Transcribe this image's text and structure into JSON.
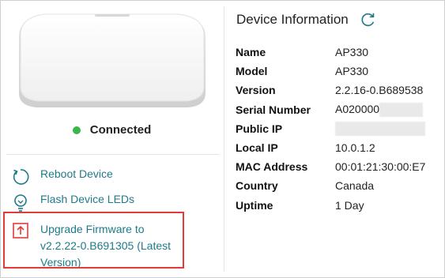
{
  "device": {
    "status_label": "Connected",
    "status_color": "#3cb54a",
    "image_icon": "access-point-image"
  },
  "actions": [
    {
      "label": "Reboot Device",
      "icon": "reboot-icon"
    },
    {
      "label": "Flash Device LEDs",
      "icon": "flash-led-icon"
    },
    {
      "label_line1": "Upgrade Firmware to",
      "label_line2": "v2.2.22-0.B691305 (Latest",
      "label_line3": "Version)",
      "icon": "upgrade-icon"
    }
  ],
  "info": {
    "title": "Device Information",
    "refresh_icon": "refresh-icon",
    "rows": [
      {
        "label": "Name",
        "value": "AP330"
      },
      {
        "label": "Model",
        "value": "AP330"
      },
      {
        "label": "Version",
        "value": "2.2.16-0.B689538"
      },
      {
        "label": "Serial Number",
        "value": "A020000"
      },
      {
        "label": "Public IP",
        "value": ""
      },
      {
        "label": "Local IP",
        "value": "10.0.1.2"
      },
      {
        "label": "MAC Address",
        "value": "00:01:21:30:00:E7"
      },
      {
        "label": "Country",
        "value": "Canada"
      },
      {
        "label": "Uptime",
        "value": "1 Day"
      }
    ]
  },
  "colors": {
    "link": "#1f7a8a",
    "highlight_border": "#e23b3b"
  }
}
